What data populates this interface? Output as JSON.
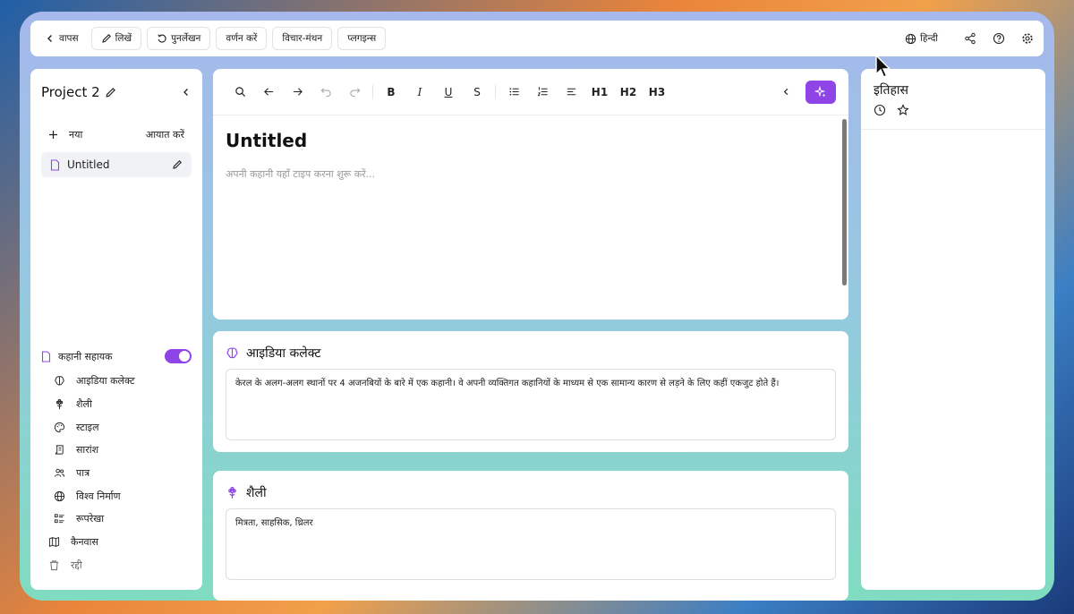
{
  "topbar": {
    "back_label": "वापस",
    "write_label": "लिखें",
    "rewrite_label": "पुनर्लेखन",
    "describe_label": "वर्णन करें",
    "brainstorm_label": "विचार-मंथन",
    "plugins_label": "प्लगइन्स",
    "language_label": "हिन्दी"
  },
  "sidebar": {
    "project_title": "Project 2",
    "new_label": "नया",
    "import_label": "आयात करें",
    "documents": [
      {
        "title": "Untitled"
      }
    ],
    "assistant_label": "कहानी सहायक",
    "assistant_enabled": true,
    "items": [
      {
        "label": "आइडिया कलेक्ट",
        "icon": "brain-icon"
      },
      {
        "label": "शैली",
        "icon": "flower-icon"
      },
      {
        "label": "स्टाइल",
        "icon": "palette-icon"
      },
      {
        "label": "सारांश",
        "icon": "scroll-icon"
      },
      {
        "label": "पात्र",
        "icon": "users-icon"
      },
      {
        "label": "विश्व निर्माण",
        "icon": "globe-icon"
      },
      {
        "label": "रूपरेखा",
        "icon": "list-icon"
      }
    ],
    "canvas_label": "कैनवास",
    "trash_label": "रद्दी"
  },
  "editor": {
    "toolbar": {
      "h1": "H1",
      "h2": "H2",
      "h3": "H3",
      "bold": "B",
      "italic": "I",
      "underline": "U",
      "strike": "S"
    },
    "title": "Untitled",
    "placeholder": "अपनी कहानी यहाँ टाइप करना शुरू करें..."
  },
  "idea_card": {
    "title": "आइडिया कलेक्ट",
    "text": "केरल के अलग-अलग स्थानों पर 4 अजनबियों के बारे में एक कहानी। वे अपनी व्यक्तिगत कहानियों के माध्यम से एक सामान्य कारण से लड़ने के लिए कहीं एकजुट होते हैं।"
  },
  "genre_card": {
    "title": "शैली",
    "text": "मित्रता, साहसिक, थ्रिलर"
  },
  "history": {
    "title": "इतिहास"
  },
  "colors": {
    "accent": "#8e44e6",
    "text": "#111111",
    "muted": "#9a9aa0"
  }
}
